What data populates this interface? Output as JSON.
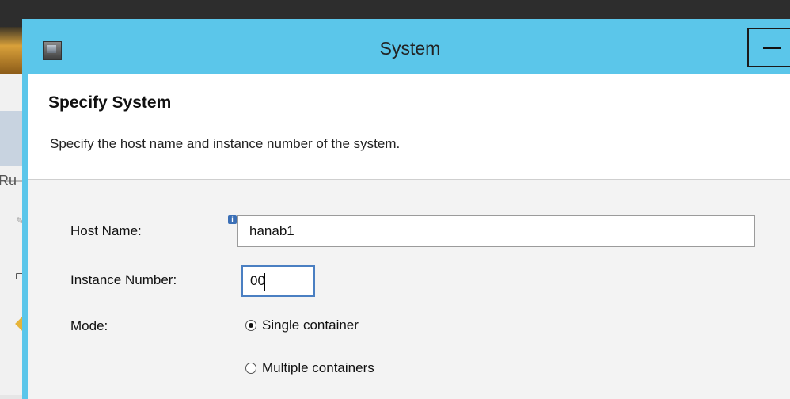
{
  "background": {
    "partial_text": "Ru"
  },
  "dialog": {
    "title": "System",
    "header_title": "Specify System",
    "header_subtitle": "Specify the host name and instance number of the system.",
    "host_name_label": "Host Name:",
    "host_name_value": "hanab1",
    "instance_number_label": "Instance Number:",
    "instance_number_value": "00",
    "mode_label": "Mode:",
    "mode_options": [
      {
        "label": "Single container",
        "selected": true
      },
      {
        "label": "Multiple containers",
        "selected": false
      }
    ]
  },
  "colors": {
    "titlebar": "#5bc6ea",
    "focus_border": "#4a7fc2"
  }
}
